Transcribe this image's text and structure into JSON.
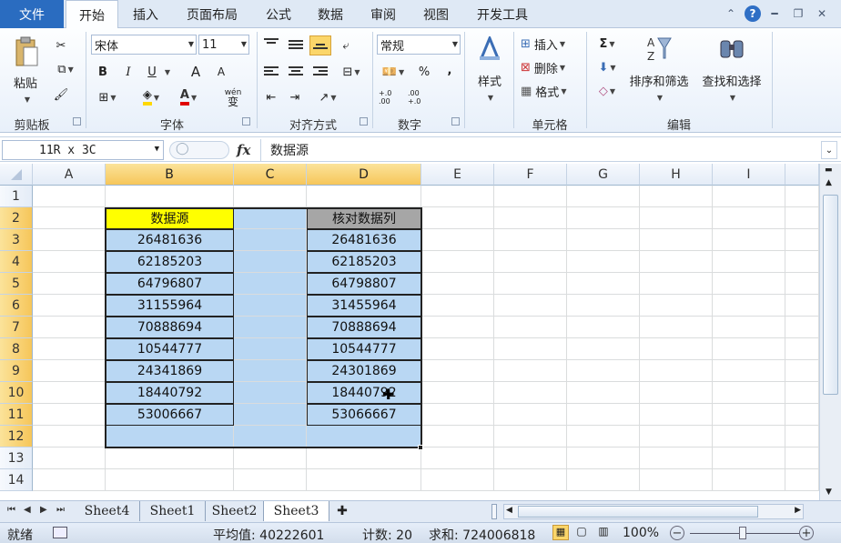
{
  "tabs": {
    "file": "文件",
    "items": [
      "开始",
      "插入",
      "页面布局",
      "公式",
      "数据",
      "审阅",
      "视图",
      "开发工具"
    ]
  },
  "ribbon": {
    "clipboard": {
      "paste": "粘贴",
      "label": "剪贴板"
    },
    "font": {
      "name": "宋体",
      "size": "11",
      "label": "字体",
      "bold": "B",
      "italic": "I",
      "underline": "U",
      "grow": "A",
      "shrink": "A",
      "font_color": "A",
      "wen": "wén",
      "wen2": "变"
    },
    "alignment": {
      "label": "对齐方式"
    },
    "number": {
      "format": "常规",
      "label": "数字",
      "percent": "%",
      "comma": ",",
      "inc": "+.0 .00",
      "dec": ".00 +.0"
    },
    "styles": {
      "label": "样式"
    },
    "cells": {
      "insert": "插入",
      "delete": "删除",
      "format": "格式",
      "label": "单元格"
    },
    "editing": {
      "sum": "Σ",
      "sort": "排序和筛选",
      "find": "查找和选择",
      "label": "编辑"
    }
  },
  "formula_bar": {
    "name_box": "11R x 3C",
    "fx": "fx",
    "content": "数据源"
  },
  "columns": [
    "A",
    "B",
    "C",
    "D",
    "E",
    "F",
    "G",
    "H",
    "I"
  ],
  "rows": [
    "1",
    "2",
    "3",
    "4",
    "5",
    "6",
    "7",
    "8",
    "9",
    "10",
    "11",
    "12",
    "13",
    "14"
  ],
  "table": {
    "header_b": "数据源",
    "header_d": "核对数据列",
    "b_values": [
      "26481636",
      "62185203",
      "64796807",
      "31155964",
      "70888694",
      "10544777",
      "24341869",
      "18440792",
      "53006667"
    ],
    "d_values": [
      "26481636",
      "62185203",
      "64798807",
      "31455964",
      "70888694",
      "10544777",
      "24301869",
      "18440792",
      "53066667"
    ]
  },
  "sheets": [
    "Sheet4",
    "Sheet1",
    "Sheet2",
    "Sheet3"
  ],
  "active_sheet": "Sheet3",
  "status": {
    "ready": "就绪",
    "average": "平均值: 40222601",
    "count": "计数: 20",
    "sum": "求和: 724006818",
    "zoom": "100%"
  },
  "colors": {
    "accent": "#2a6cc0",
    "selection": "#b9d7f3",
    "header_b": "#ffff00",
    "header_d": "#a6a6a6"
  }
}
